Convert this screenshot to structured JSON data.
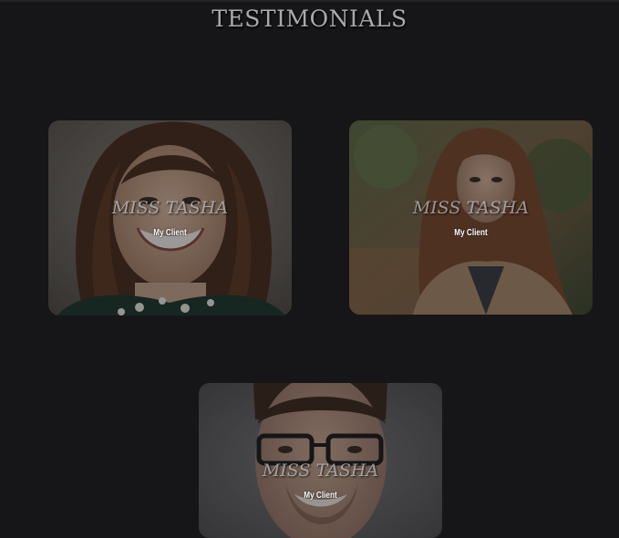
{
  "section": {
    "title": "TESTIMONIALS"
  },
  "testimonials": [
    {
      "name": "MISS TASHA",
      "role": "My Client",
      "photo": "woman-curly-hair-smiling-photo"
    },
    {
      "name": "MISS TASHA",
      "role": "My Client",
      "photo": "woman-long-hair-outdoor-photo"
    },
    {
      "name": "MISS TASHA",
      "role": "My Client",
      "photo": "man-glasses-smiling-photo"
    }
  ],
  "colors": {
    "background": "#161618",
    "title": "#a9a9ab",
    "name": "#e1e1e1",
    "role": "#ffffff"
  }
}
